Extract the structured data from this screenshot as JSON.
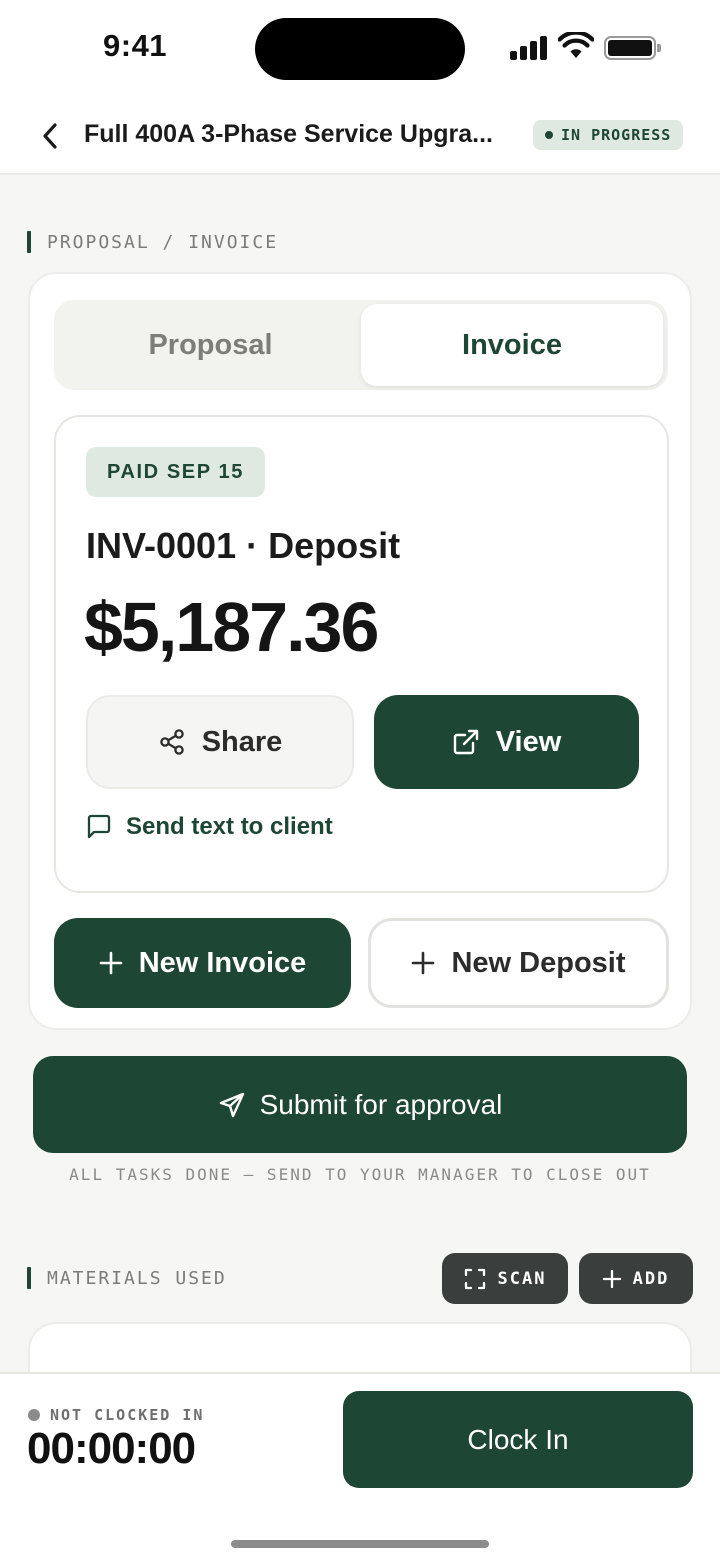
{
  "status_bar": {
    "time": "9:41"
  },
  "header": {
    "title": "Full 400A 3-Phase Service Upgra...",
    "status_badge": "IN PROGRESS"
  },
  "proposal_invoice_section": {
    "label": "PROPOSAL / INVOICE",
    "tabs": [
      {
        "label": "Proposal",
        "selected": false
      },
      {
        "label": "Invoice",
        "selected": true
      }
    ],
    "invoice": {
      "paid_badge": "PAID SEP 15",
      "title": "INV-0001 · Deposit",
      "amount": "$5,187.36",
      "share_label": "Share",
      "view_label": "View",
      "send_text_label": "Send text to client"
    },
    "new_invoice_label": "New Invoice",
    "new_deposit_label": "New Deposit"
  },
  "submit": {
    "label": "Submit for approval",
    "note": "ALL TASKS DONE — SEND TO YOUR MANAGER TO CLOSE OUT"
  },
  "materials_section": {
    "label": "MATERIALS USED",
    "scan_label": "SCAN",
    "add_label": "ADD"
  },
  "bottom_bar": {
    "clock_status": "NOT CLOCKED IN",
    "timer": "00:00:00",
    "clock_in_label": "Clock In"
  },
  "colors": {
    "accent": "#1e4634",
    "badge_bg": "#dfe9e2",
    "chip_bg": "#3a3f3d",
    "background": "#f6f6f5"
  }
}
